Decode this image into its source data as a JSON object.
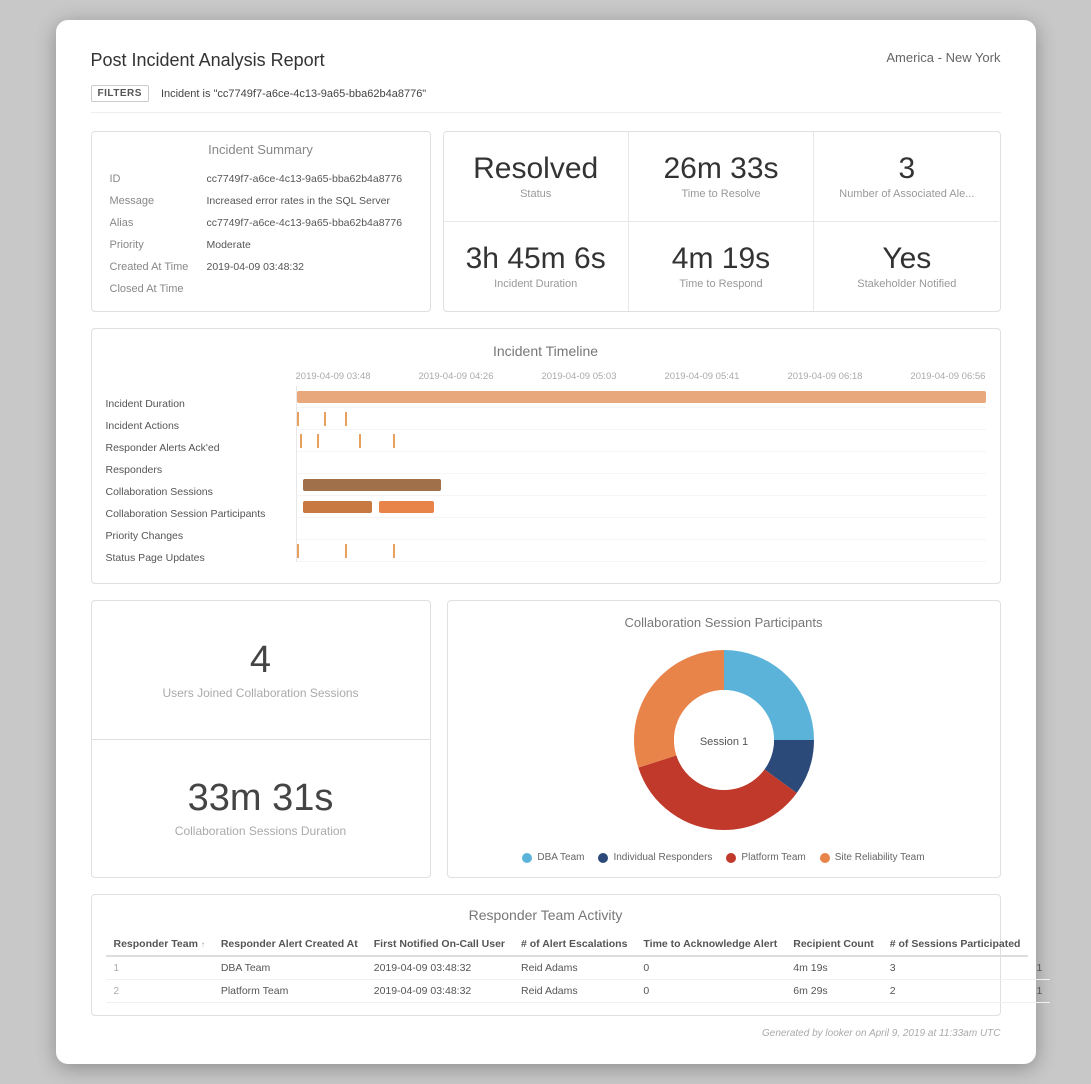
{
  "report": {
    "title": "Post Incident Analysis Report",
    "region": "America - New York"
  },
  "filters": {
    "label": "FILTERS",
    "value": "Incident is \"cc7749f7-a6ce-4c13-9a65-bba62b4a8776\""
  },
  "incident_summary": {
    "title": "Incident Summary",
    "rows": [
      {
        "label": "ID",
        "value": "cc7749f7-a6ce-4c13-9a65-bba62b4a8776"
      },
      {
        "label": "Message",
        "value": "Increased error rates in the SQL Server"
      },
      {
        "label": "Alias",
        "value": "cc7749f7-a6ce-4c13-9a65-bba62b4a8776"
      },
      {
        "label": "Priority",
        "value": "Moderate"
      },
      {
        "label": "Created At Time",
        "value": "2019-04-09 03:48:32"
      },
      {
        "label": "Closed At Time",
        "value": ""
      }
    ]
  },
  "metrics": [
    {
      "value": "Resolved",
      "label": "Status"
    },
    {
      "value": "26m 33s",
      "label": "Time to Resolve"
    },
    {
      "value": "3",
      "label": "Number of Associated Ale..."
    },
    {
      "value": "3h 45m 6s",
      "label": "Incident Duration"
    },
    {
      "value": "4m 19s",
      "label": "Time to Respond"
    },
    {
      "value": "Yes",
      "label": "Stakeholder Notified"
    }
  ],
  "timeline": {
    "title": "Incident Timeline",
    "axis_labels": [
      "2019-04-09 03:48",
      "2019-04-09 04:26",
      "2019-04-09 05:03",
      "2019-04-09 05:41",
      "2019-04-09 06:18",
      "2019-04-09 06:56"
    ],
    "row_labels": [
      "Incident Duration",
      "Incident Actions",
      "Responder Alerts Ack'ed",
      "Responders",
      "Collaboration Sessions",
      "Collaboration Session Participants",
      "Priority Changes",
      "Status Page Updates"
    ]
  },
  "collab": {
    "users_value": "4",
    "users_label": "Users Joined Collaboration Sessions",
    "duration_value": "33m 31s",
    "duration_label": "Collaboration Sessions Duration"
  },
  "donut": {
    "title": "Collaboration Session Participants",
    "center_label": "Session 1",
    "legend": [
      {
        "label": "DBA Team",
        "color": "#5cb3d9"
      },
      {
        "label": "Individual Responders",
        "color": "#2b4a7a"
      },
      {
        "label": "Platform Team",
        "color": "#c0392b"
      },
      {
        "label": "Site Reliability Team",
        "color": "#e8834a"
      }
    ],
    "segments": [
      {
        "color": "#5cb3d9",
        "pct": 25
      },
      {
        "color": "#2b4a7a",
        "pct": 10
      },
      {
        "color": "#c0392b",
        "pct": 35
      },
      {
        "color": "#e8834a",
        "pct": 30
      }
    ]
  },
  "responder_table": {
    "title": "Responder Team Activity",
    "columns": [
      "Responder Team",
      "Responder Alert Created At",
      "First Notified On-Call User",
      "# of Alert Escalations",
      "Time to Acknowledge Alert",
      "Recipient Count",
      "# of Sessions Participated"
    ],
    "rows": [
      {
        "num": "1",
        "team": "DBA Team",
        "created": "2019-04-09 03:48:32",
        "user": "Reid Adams",
        "escalations": "0",
        "time_ack": "4m 19s",
        "recipients": "3",
        "sessions": "1"
      },
      {
        "num": "2",
        "team": "Platform Team",
        "created": "2019-04-09 03:48:32",
        "user": "Reid Adams",
        "escalations": "0",
        "time_ack": "6m 29s",
        "recipients": "2",
        "sessions": "1"
      }
    ]
  },
  "footer": {
    "text": "Generated by looker on April 9, 2019 at 11:33am UTC"
  }
}
